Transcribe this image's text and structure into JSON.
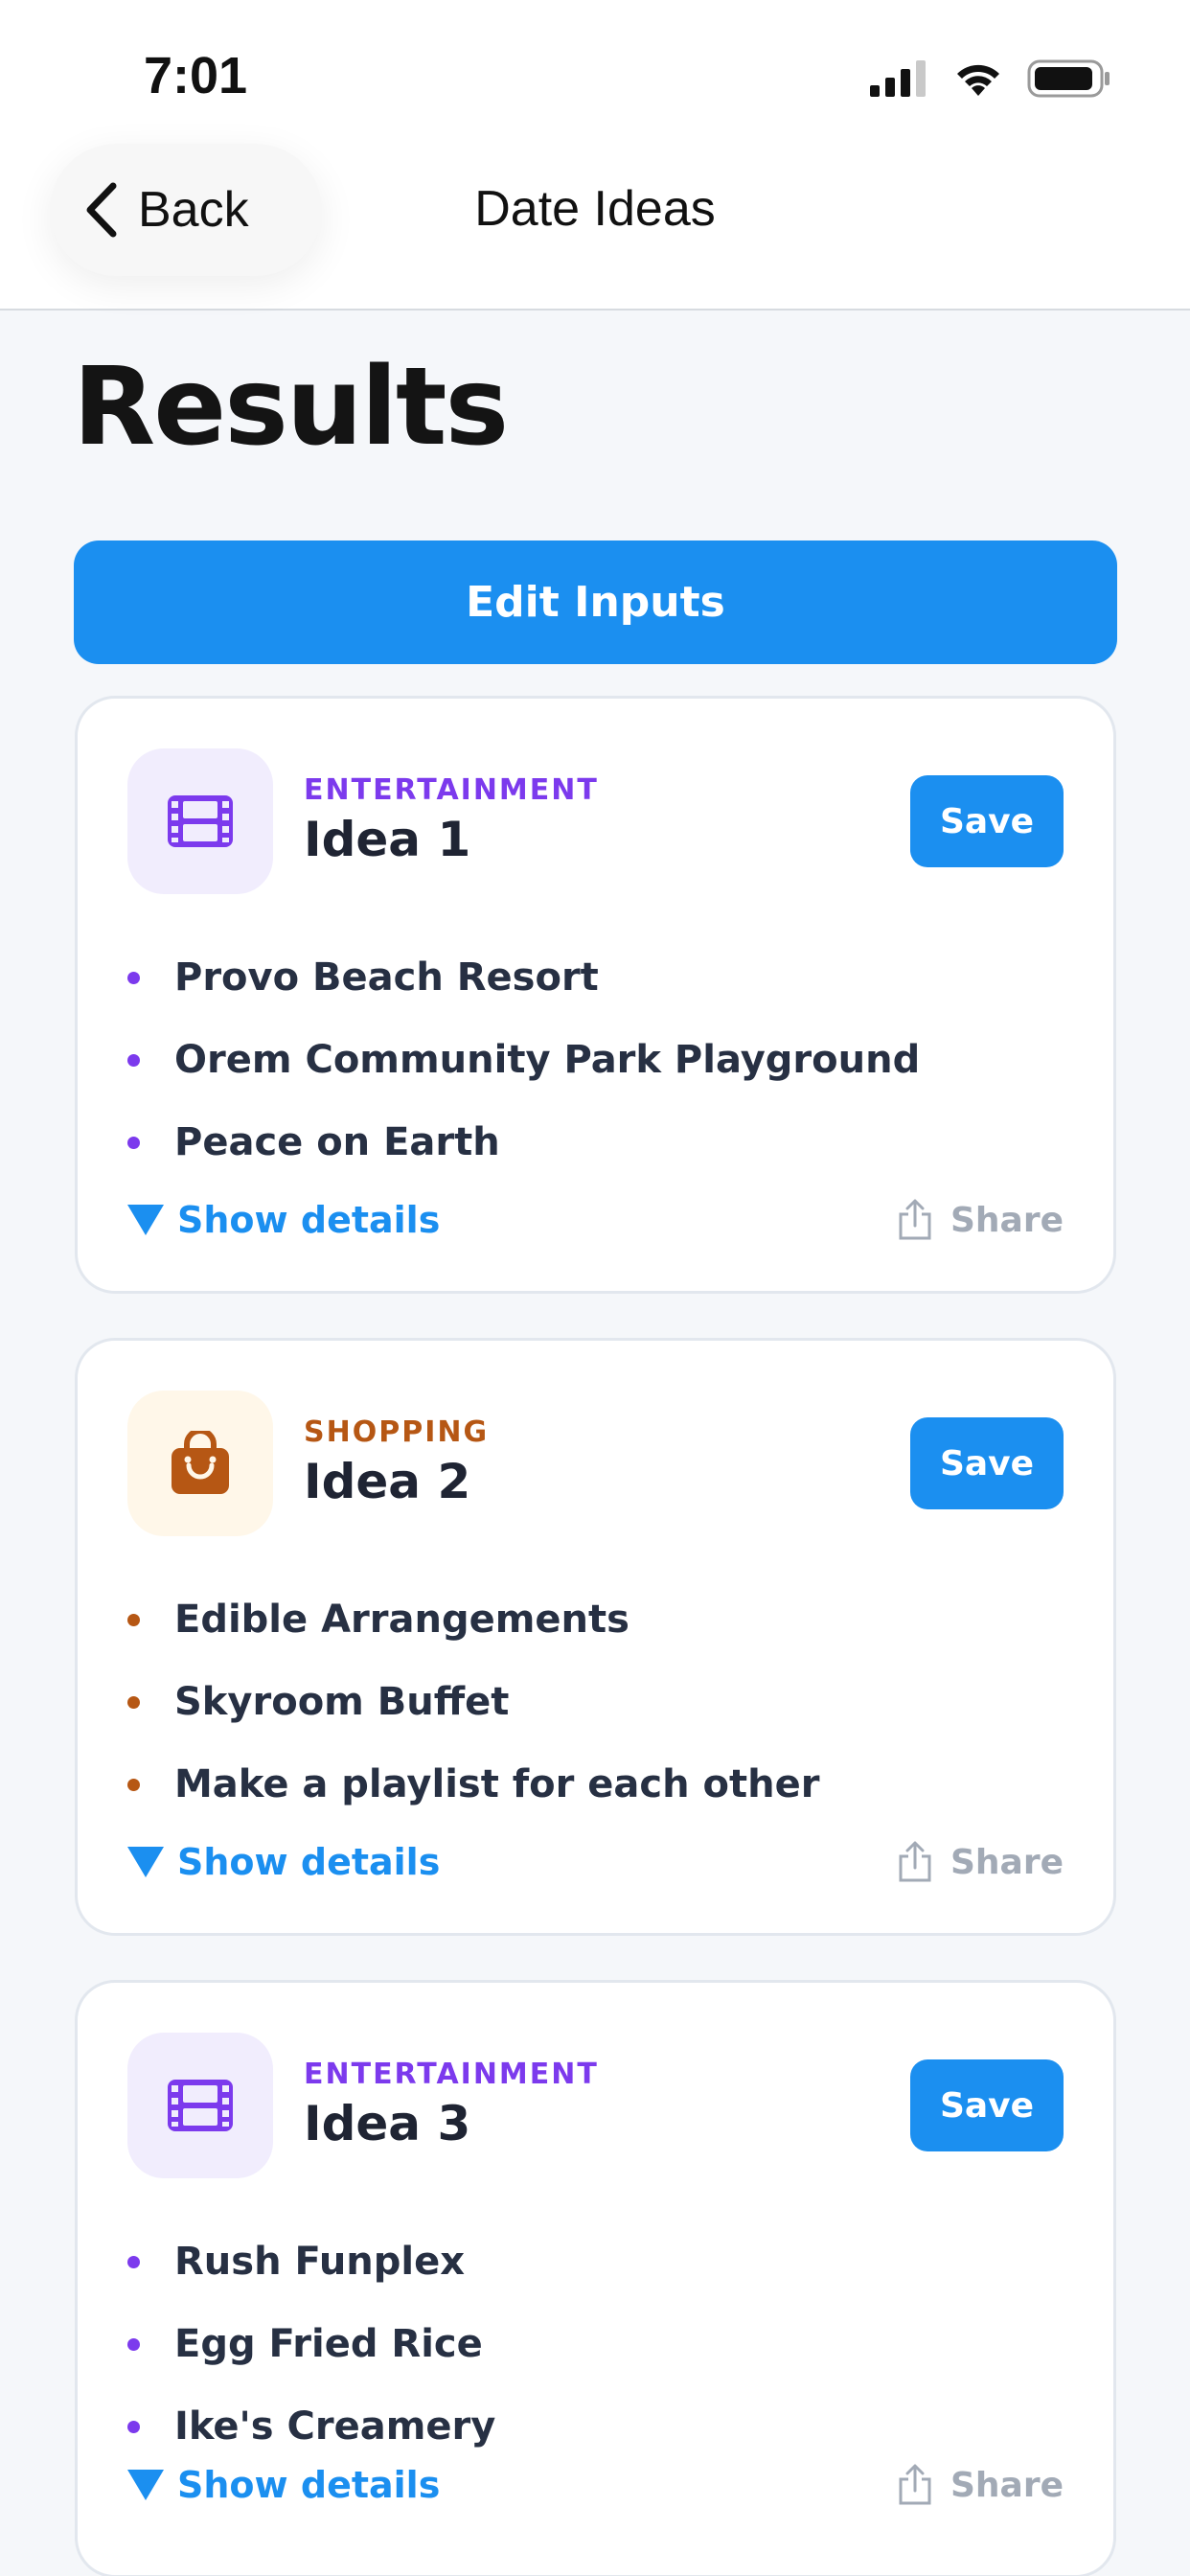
{
  "status_bar": {
    "time": "7:01",
    "icons": [
      "cellular-signal-icon",
      "wifi-icon",
      "battery-icon"
    ]
  },
  "nav": {
    "back_label": "Back",
    "title": "Date Ideas"
  },
  "page": {
    "heading": "Results",
    "edit_inputs_label": "Edit Inputs"
  },
  "colors": {
    "primary": "#1b8ff0",
    "entertainment": "#7c3aed",
    "entertainment_bg": "#f1edfd",
    "shopping": "#b65714",
    "shopping_bg": "#fff7e9",
    "text": "#273043",
    "muted": "#a2aab6"
  },
  "cards": [
    {
      "category": "ENTERTAINMENT",
      "category_icon": "film-icon",
      "title": "Idea 1",
      "save_label": "Save",
      "items": [
        "Provo Beach Resort",
        "Orem Community Park Playground",
        "Peace on Earth"
      ],
      "show_details_label": "Show details",
      "share_label": "Share"
    },
    {
      "category": "SHOPPING",
      "category_icon": "shopping-bag-icon",
      "title": "Idea 2",
      "save_label": "Save",
      "items": [
        "Edible Arrangements",
        "Skyroom Buffet",
        "Make a playlist for each other"
      ],
      "show_details_label": "Show details",
      "share_label": "Share"
    },
    {
      "category": "ENTERTAINMENT",
      "category_icon": "film-icon",
      "title": "Idea 3",
      "save_label": "Save",
      "items": [
        "Rush Funplex",
        "Egg Fried Rice",
        "Ike's Creamery"
      ],
      "show_details_label": "Show details",
      "share_label": "Share"
    }
  ]
}
